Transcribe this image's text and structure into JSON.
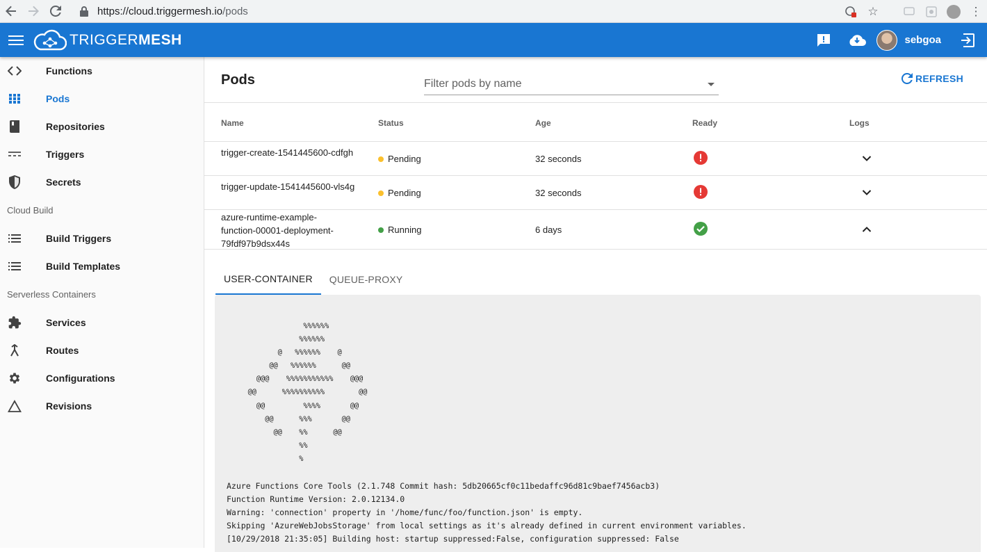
{
  "browser": {
    "url_host": "https://cloud.triggermesh.io",
    "url_path": "/pods"
  },
  "app": {
    "brand_light": "TRIGGER",
    "brand_bold": "MESH",
    "username": "sebgoa",
    "colors": {
      "primary": "#1976d2",
      "pending": "#fbc02d",
      "running": "#43a047",
      "error": "#e53935"
    }
  },
  "sidebar": {
    "items": [
      {
        "label": "Functions",
        "icon": "code-icon"
      },
      {
        "label": "Pods",
        "icon": "grid-icon",
        "active": true
      },
      {
        "label": "Repositories",
        "icon": "book-icon"
      },
      {
        "label": "Triggers",
        "icon": "dashes-icon"
      },
      {
        "label": "Secrets",
        "icon": "shield-icon"
      }
    ],
    "section_cloud_build": "Cloud Build",
    "cloud_build_items": [
      {
        "label": "Build Triggers",
        "icon": "list-icon"
      },
      {
        "label": "Build Templates",
        "icon": "list-icon"
      }
    ],
    "section_serverless": "Serverless Containers",
    "serverless_items": [
      {
        "label": "Services",
        "icon": "puzzle-icon"
      },
      {
        "label": "Routes",
        "icon": "merge-icon"
      },
      {
        "label": "Configurations",
        "icon": "gear-icon"
      },
      {
        "label": "Revisions",
        "icon": "triangle-icon"
      }
    ]
  },
  "main": {
    "title": "Pods",
    "filter_placeholder": "Filter pods by name",
    "refresh_label": "REFRESH",
    "columns": [
      "Name",
      "Status",
      "Age",
      "Ready",
      "Logs"
    ],
    "rows": [
      {
        "name": "trigger-create-1541445600-cdfgh",
        "status": "Pending",
        "age": "32 seconds",
        "ready": false,
        "expanded": false
      },
      {
        "name": "trigger-update-1541445600-vls4g",
        "status": "Pending",
        "age": "32 seconds",
        "ready": false,
        "expanded": false
      },
      {
        "name": "azure-runtime-example-function-00001-deployment-79fdf97b9dsx44s",
        "status": "Running",
        "age": "6 days",
        "ready": true,
        "expanded": true
      }
    ],
    "tabs": [
      "USER-CONTAINER",
      "QUEUE-PROXY"
    ],
    "log_ascii": "                  %%%%%%\n                 %%%%%%\n            @   %%%%%%    @\n          @@   %%%%%%      @@\n       @@@    %%%%%%%%%%%    @@@\n     @@      %%%%%%%%%%        @@\n       @@         %%%%       @@\n         @@      %%%       @@\n           @@    %%      @@\n                 %%\n                 %",
    "log_lines": "Azure Functions Core Tools (2.1.748 Commit hash: 5db20665cf0c11bedaffc96d81c9baef7456acb3)\nFunction Runtime Version: 2.0.12134.0\nWarning: 'connection' property in '/home/func/foo/function.json' is empty.\nSkipping 'AzureWebJobsStorage' from local settings as it's already defined in current environment variables.\n[10/29/2018 21:35:05] Building host: startup suppressed:False, configuration suppressed: False"
  }
}
